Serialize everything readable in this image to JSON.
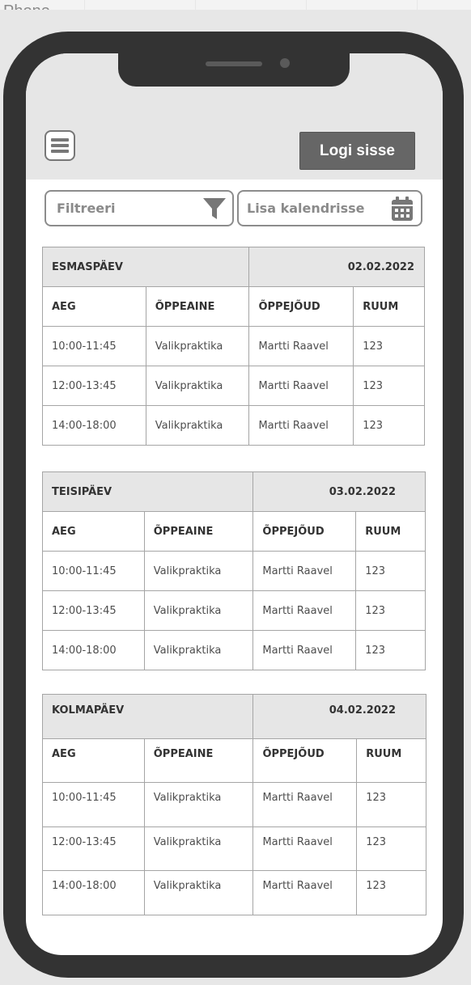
{
  "frame": {
    "label": "Phone"
  },
  "header": {
    "login_label": "Logi sisse"
  },
  "filters": {
    "filter_label": "Filtreeri",
    "calendar_label": "Lisa kalendrisse"
  },
  "columns": [
    "AEG",
    "ÕPPEAINE",
    "ÕPPEJÕUD",
    "RUUM"
  ],
  "days": [
    {
      "name": "ESMASPÄEV",
      "date": "02.02.2022",
      "rows": [
        [
          "10:00-11:45",
          "Valikpraktika",
          "Martti Raavel",
          "123"
        ],
        [
          "12:00-13:45",
          "Valikpraktika",
          "Martti Raavel",
          "123"
        ],
        [
          "14:00-18:00",
          "Valikpraktika",
          "Martti Raavel",
          "123"
        ]
      ]
    },
    {
      "name": "TEISIPÄEV",
      "date": "03.02.2022",
      "rows": [
        [
          "10:00-11:45",
          "Valikpraktika",
          "Martti Raavel",
          "123"
        ],
        [
          "12:00-13:45",
          "Valikpraktika",
          "Martti Raavel",
          "123"
        ],
        [
          "14:00-18:00",
          "Valikpraktika",
          "Martti Raavel",
          "123"
        ]
      ]
    },
    {
      "name": "KOLMAPÄEV",
      "date": "04.02.2022",
      "rows": [
        [
          "10:00-11:45",
          "Valikpraktika",
          "Martti Raavel",
          "123"
        ],
        [
          "12:00-13:45",
          "Valikpraktika",
          "Martti Raavel",
          "123"
        ],
        [
          "14:00-18:00",
          "Valikpraktika",
          "Martti Raavel",
          "123"
        ]
      ]
    }
  ]
}
